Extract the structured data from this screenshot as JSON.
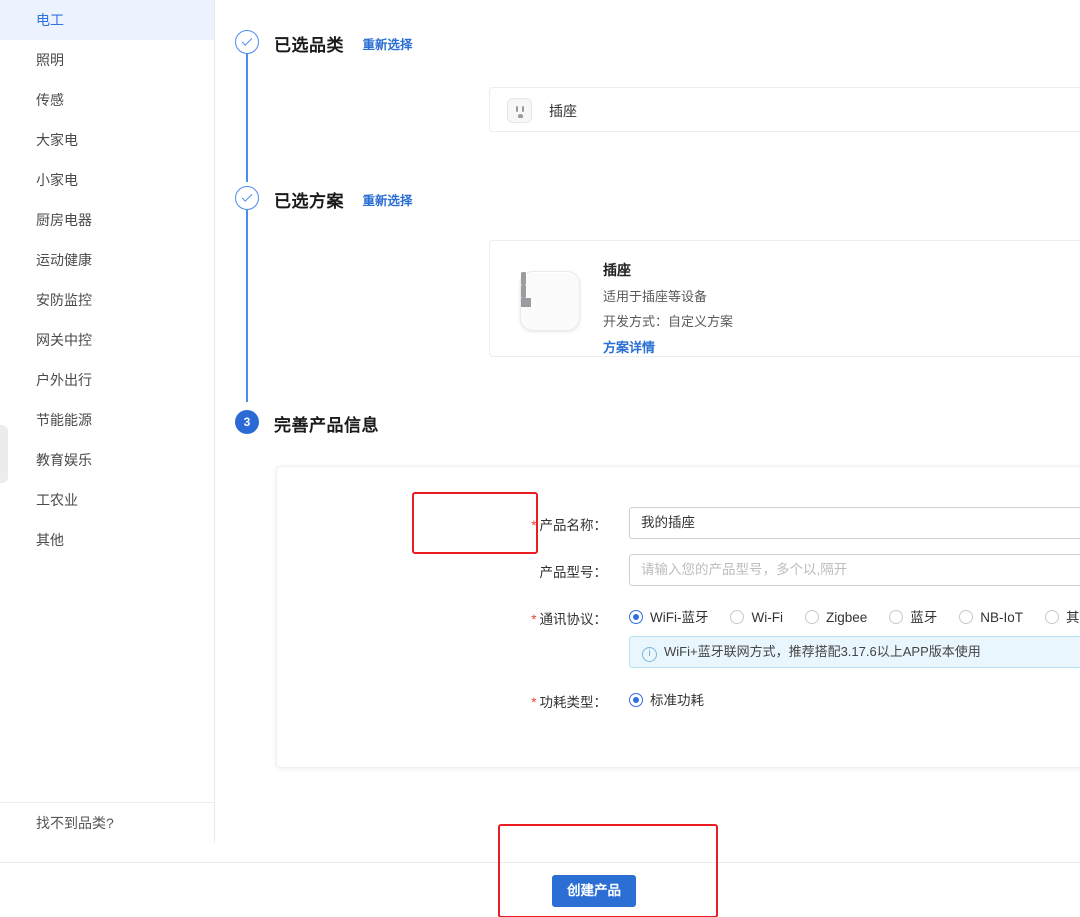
{
  "sidebar": {
    "items": [
      {
        "label": "电工",
        "active": true
      },
      {
        "label": "照明",
        "active": false
      },
      {
        "label": "传感",
        "active": false
      },
      {
        "label": "大家电",
        "active": false
      },
      {
        "label": "小家电",
        "active": false
      },
      {
        "label": "厨房电器",
        "active": false
      },
      {
        "label": "运动健康",
        "active": false
      },
      {
        "label": "安防监控",
        "active": false
      },
      {
        "label": "网关中控",
        "active": false
      },
      {
        "label": "户外出行",
        "active": false
      },
      {
        "label": "节能能源",
        "active": false
      },
      {
        "label": "教育娱乐",
        "active": false
      },
      {
        "label": "工农业",
        "active": false
      },
      {
        "label": "其他",
        "active": false
      }
    ],
    "footer_label": "找不到品类?"
  },
  "steps": {
    "step1": {
      "marker": "✓",
      "title": "已选品类",
      "relink": "重新选择",
      "selected_category": "插座"
    },
    "step2": {
      "marker": "✓",
      "title": "已选方案",
      "relink": "重新选择",
      "plan": {
        "name": "插座",
        "desc1": "适用于插座等设备",
        "desc2": "开发方式：自定义方案",
        "detail_link": "方案详情"
      }
    },
    "step3": {
      "marker": "3",
      "title": "完善产品信息"
    }
  },
  "form": {
    "product_name": {
      "label": "产品名称：",
      "required": true,
      "value": "我的插座"
    },
    "product_model": {
      "label": "产品型号：",
      "required": false,
      "value": "",
      "placeholder": "请输入您的产品型号，多个以,隔开"
    },
    "protocol": {
      "label": "通讯协议：",
      "required": true,
      "options": [
        {
          "label": "WiFi-蓝牙",
          "selected": true
        },
        {
          "label": "Wi-Fi",
          "selected": false
        },
        {
          "label": "Zigbee",
          "selected": false
        },
        {
          "label": "蓝牙",
          "selected": false
        },
        {
          "label": "NB-IoT",
          "selected": false
        },
        {
          "label": "其他",
          "selected": false
        }
      ],
      "alert": "WiFi+蓝牙联网方式，推荐搭配3.17.6以上APP版本使用"
    },
    "power_type": {
      "label": "功耗类型：",
      "required": true,
      "options": [
        {
          "label": "标准功耗",
          "selected": true
        }
      ]
    }
  },
  "footer": {
    "create_button": "创建产品"
  },
  "colors": {
    "accent": "#2b6fd4",
    "link": "#2b6fd4",
    "annotation": "#ec1c24",
    "required": "#e8453c",
    "sidebar_active_bg": "#ecf3fe"
  }
}
